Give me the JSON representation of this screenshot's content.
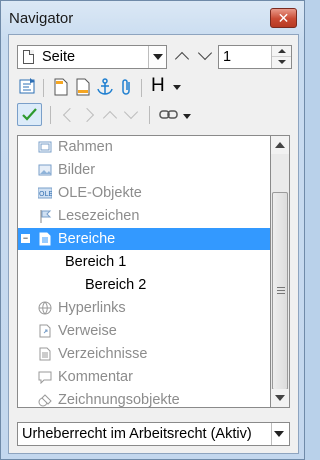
{
  "window": {
    "title": "Navigator",
    "close_glyph": "✕"
  },
  "toolbar": {
    "category": "Seite",
    "page_number": "1",
    "heading_label": "H"
  },
  "tree": {
    "items": [
      {
        "label": "Rahmen",
        "icon": "frame-icon"
      },
      {
        "label": "Bilder",
        "icon": "image-icon"
      },
      {
        "label": "OLE-Objekte",
        "icon": "ole-icon"
      },
      {
        "label": "Lesezeichen",
        "icon": "bookmark-icon"
      },
      {
        "label": "Bereiche",
        "icon": "section-icon",
        "expanded": true,
        "selected": true
      },
      {
        "label": "Bereich 1",
        "icon": ""
      },
      {
        "label": "Bereich 2",
        "icon": ""
      },
      {
        "label": "Hyperlinks",
        "icon": "hyperlink-icon"
      },
      {
        "label": "Verweise",
        "icon": "reference-icon"
      },
      {
        "label": "Verzeichnisse",
        "icon": "index-icon"
      },
      {
        "label": "Kommentar",
        "icon": "comment-icon"
      },
      {
        "label": "Zeichnungsobjekte",
        "icon": "drawing-icon"
      }
    ],
    "expand_glyph": "−"
  },
  "document_select": {
    "value": "Urheberrecht im Arbeitsrecht (Aktiv)"
  },
  "colors": {
    "selection": "#3399ff",
    "check": "#2e9a2e",
    "anchor": "#1f7fd0"
  }
}
